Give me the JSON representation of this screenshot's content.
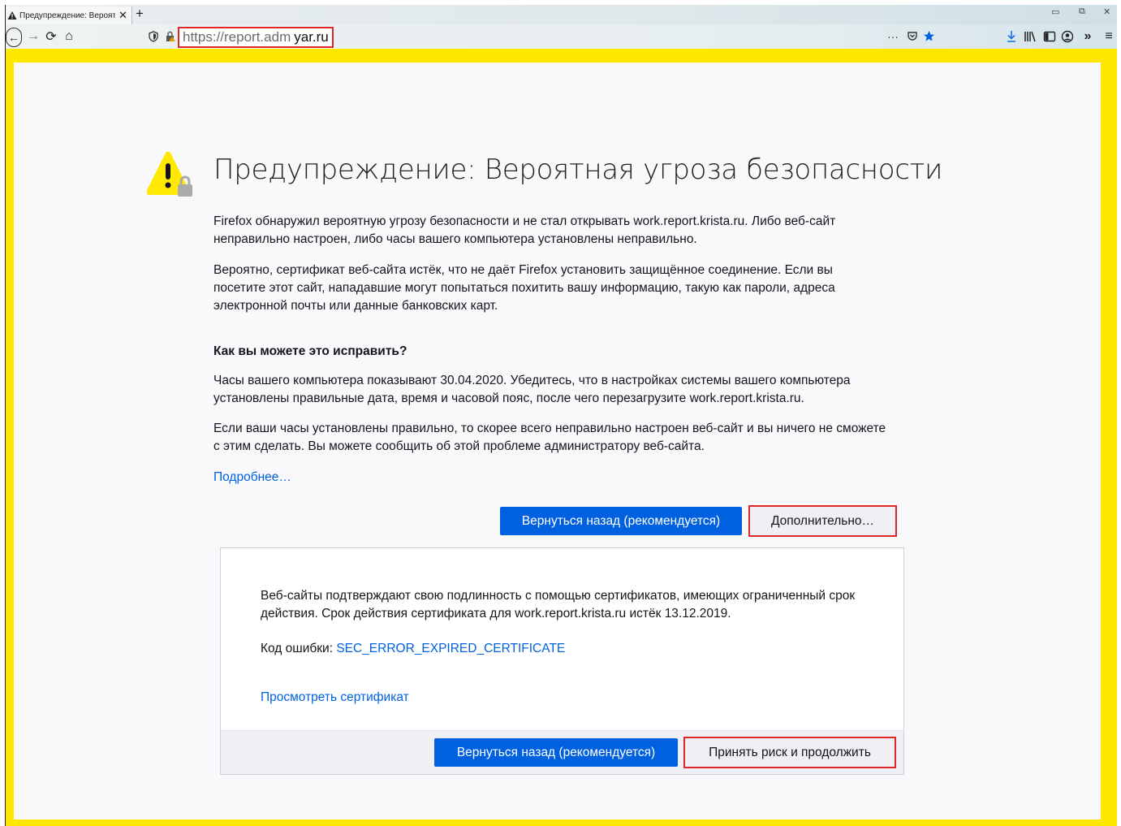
{
  "tab": {
    "title": "Предупреждение: Вероятная",
    "close": "✕",
    "new_tab": "+"
  },
  "window_controls": {
    "minimize": "▭",
    "restore": "⧉",
    "close": "✕"
  },
  "navbar": {
    "back": "←",
    "forward": "→",
    "reload": "⟳",
    "home": "⌂",
    "url_protocol": "https://report.adm",
    "url_host": "yar.ru",
    "more": "···",
    "overflow": "»",
    "menu": "≡"
  },
  "page": {
    "heading": "Предупреждение: Вероятная угроза безопасности",
    "para1": "Firefox обнаружил вероятную угрозу безопасности и не стал открывать work.report.krista.ru. Либо веб-сайт неправильно настроен, либо часы вашего компьютера установлены неправильно.",
    "para2": "Вероятно, сертификат веб-сайта истёк, что не даёт Firefox установить защищённое соединение. Если вы посетите этот сайт, нападавшие могут попытаться похитить вашу информацию, такую как пароли, адреса электронной почты или данные банковских карт.",
    "how_heading": "Как вы можете это исправить?",
    "para3": "Часы вашего компьютера показывают 30.04.2020. Убедитесь, что в настройках системы вашего компьютера установлены правильные дата, время и часовой пояс, после чего перезагрузите work.report.krista.ru.",
    "para4": "Если ваши часы установлены правильно, то скорее всего неправильно настроен веб-сайт и вы ничего не сможете с этим сделать. Вы можете сообщить об этой проблеме администратору веб-сайта.",
    "learn_more": "Подробнее…",
    "go_back_button": "Вернуться назад (рекомендуется)",
    "advanced_button": "Дополнительно…"
  },
  "advanced": {
    "text": "Веб-сайты подтверждают свою подлинность с помощью сертификатов, имеющих ограниченный срок действия. Срок действия сертификата для work.report.krista.ru истёк 13.12.2019.",
    "error_label": "Код ошибки:",
    "error_code": "SEC_ERROR_EXPIRED_CERTIFICATE",
    "view_cert": "Просмотреть сертификат",
    "go_back_button": "Вернуться назад (рекомендуется)",
    "accept_button": "Принять риск и продолжить"
  },
  "colors": {
    "accent": "#0061e0",
    "highlight_border": "#e0262a",
    "frame_yellow": "#ffe800"
  }
}
